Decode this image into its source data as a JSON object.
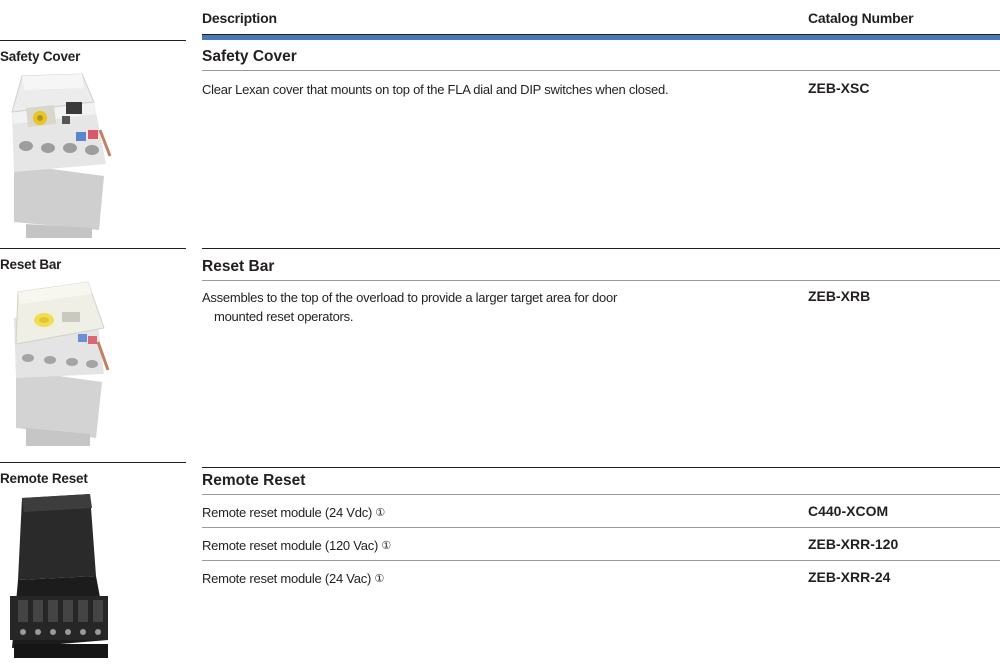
{
  "header": {
    "description": "Description",
    "catalog_number": "Catalog Number"
  },
  "sections": [
    {
      "side_title": "Safety Cover",
      "title": "Safety Cover",
      "rows": [
        {
          "description": "Clear Lexan cover that mounts on top of the FLA dial and DIP switches when closed.",
          "catalog": "ZEB-XSC"
        }
      ]
    },
    {
      "side_title": "Reset Bar",
      "title": "Reset Bar",
      "rows": [
        {
          "description_line1": "Assembles to the top of the overload to provide a larger target area for door",
          "description_line2": "mounted reset operators.",
          "catalog": "ZEB-XRB"
        }
      ]
    },
    {
      "side_title": "Remote Reset",
      "title": "Remote Reset",
      "footnote_mark": "①",
      "rows": [
        {
          "description": "Remote reset module (24 Vdc)",
          "catalog": "C440-XCOM"
        },
        {
          "description": "Remote reset module (120 Vac)",
          "catalog": "ZEB-XRR-120"
        },
        {
          "description": "Remote reset module (24 Vac)",
          "catalog": "ZEB-XRR-24"
        }
      ]
    }
  ]
}
